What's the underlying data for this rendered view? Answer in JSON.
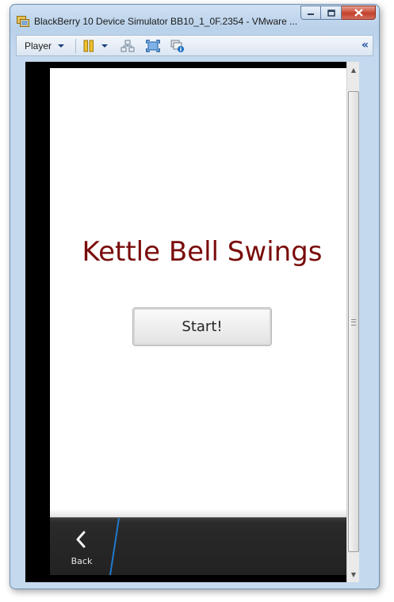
{
  "window": {
    "title": "BlackBerry 10 Device Simulator BB10_1_0F.2354 - VMware ...",
    "controls": [
      "minimize",
      "maximize",
      "close"
    ]
  },
  "toolbar": {
    "player_menu_label": "Player",
    "icons": [
      "pause-icon",
      "network-icon",
      "fullscreen-icon",
      "unity-icon"
    ],
    "collapse_glyph": "«"
  },
  "app": {
    "title": "Kettle Bell Swings",
    "start_button_label": "Start!",
    "back_label": "Back"
  },
  "colors": {
    "title_color": "#7a0c0c",
    "accent_blue": "#1f7acc"
  }
}
